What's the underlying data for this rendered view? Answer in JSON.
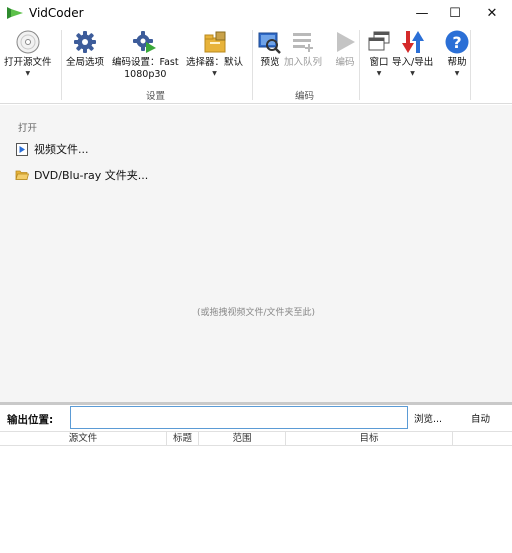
{
  "app": {
    "title": "VidCoder",
    "window_controls": {
      "minimize": "—",
      "maximize": "☐",
      "close": "✕"
    }
  },
  "ribbon": {
    "open_source": {
      "label": "打开源文件",
      "icon": "disc-icon"
    },
    "settings": {
      "global_options": {
        "label": "全局选项",
        "icon": "gear-icon"
      },
      "encode_settings": {
        "label": "编码设置：Fast",
        "label2": "1080p30",
        "icon": "gear-play-icon"
      },
      "picker": {
        "label": "选择器：默认",
        "icon": "folder-picker-icon"
      },
      "group_label": "设置"
    },
    "encode": {
      "preview": {
        "label": "预览",
        "icon": "preview-icon"
      },
      "add_to_queue": {
        "label": "加入队列",
        "icon": "queue-add-icon"
      },
      "encode": {
        "label": "编码",
        "icon": "play-icon"
      },
      "group_label": "编码"
    },
    "window": {
      "label": "窗口",
      "icon": "windows-icon"
    },
    "import_export": {
      "label": "导入/导出",
      "icon": "import-export-icon"
    },
    "help": {
      "label": "帮助",
      "icon": "help-icon"
    }
  },
  "main": {
    "open_heading": "打开",
    "video_file": "视频文件...",
    "disc_folder": "DVD/Blu-ray 文件夹...",
    "drop_hint": "(或拖拽视频文件/文件夹至此)"
  },
  "output": {
    "label": "输出位置:",
    "value": "",
    "browse": "浏览...",
    "auto": "自动"
  },
  "queue_table": {
    "columns": [
      "源文件",
      "标题",
      "范围",
      "目标"
    ]
  },
  "colors": {
    "accent_blue": "#1f6fd1",
    "help_blue": "#2b6fd6",
    "arrow_red": "#d42a2a",
    "logo_green": "#3aa83a",
    "folder_yellow": "#e8b33a"
  }
}
